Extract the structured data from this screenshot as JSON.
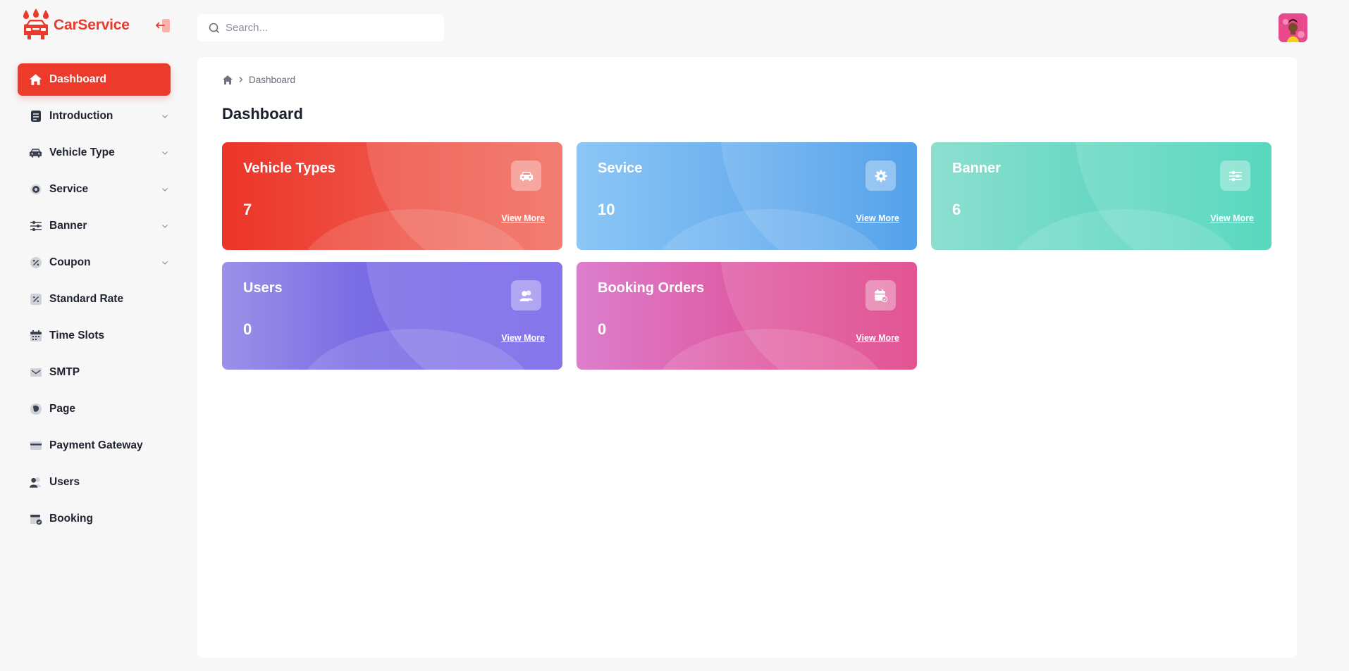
{
  "brand": {
    "name": "CarService",
    "accent": "#ec3a2b"
  },
  "search": {
    "placeholder": "Search..."
  },
  "sidebar": {
    "items": [
      {
        "label": "Dashboard",
        "icon": "home-icon",
        "active": true,
        "has_submenu": false
      },
      {
        "label": "Introduction",
        "icon": "document-icon",
        "active": false,
        "has_submenu": true
      },
      {
        "label": "Vehicle Type",
        "icon": "car-icon",
        "active": false,
        "has_submenu": true
      },
      {
        "label": "Service",
        "icon": "gear-icon",
        "active": false,
        "has_submenu": true
      },
      {
        "label": "Banner",
        "icon": "sliders-icon",
        "active": false,
        "has_submenu": true
      },
      {
        "label": "Coupon",
        "icon": "coupon-icon",
        "active": false,
        "has_submenu": true
      },
      {
        "label": "Standard Rate",
        "icon": "percent-icon",
        "active": false,
        "has_submenu": false
      },
      {
        "label": "Time Slots",
        "icon": "calendar-icon",
        "active": false,
        "has_submenu": false
      },
      {
        "label": "SMTP",
        "icon": "mail-icon",
        "active": false,
        "has_submenu": false
      },
      {
        "label": "Page",
        "icon": "page-icon",
        "active": false,
        "has_submenu": false
      },
      {
        "label": "Payment Gateway",
        "icon": "credit-card-icon",
        "active": false,
        "has_submenu": false
      },
      {
        "label": "Users",
        "icon": "users-icon",
        "active": false,
        "has_submenu": false
      },
      {
        "label": "Booking",
        "icon": "booking-icon",
        "active": false,
        "has_submenu": false
      }
    ]
  },
  "breadcrumb": {
    "current": "Dashboard"
  },
  "page": {
    "title": "Dashboard"
  },
  "cards": [
    {
      "title": "Vehicle Types",
      "value": "7",
      "link": "View More",
      "icon": "car-icon",
      "color": "#ec3427"
    },
    {
      "title": "Sevice",
      "value": "10",
      "link": "View More",
      "icon": "gear-icon",
      "color": "#3a94e8"
    },
    {
      "title": "Banner",
      "value": "6",
      "link": "View More",
      "icon": "sliders-icon",
      "color": "#40d3b5"
    },
    {
      "title": "Users",
      "value": "0",
      "link": "View More",
      "icon": "users-icon",
      "color": "#7561e9"
    },
    {
      "title": "Booking Orders",
      "value": "0",
      "link": "View More",
      "icon": "booking-icon",
      "color": "#de3b82"
    }
  ]
}
